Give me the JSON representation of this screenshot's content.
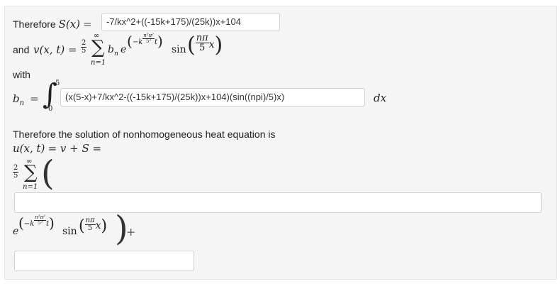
{
  "line1": {
    "therefore": "Therefore",
    "fn_S": "S",
    "arg_x": "(x)",
    "equals": "=",
    "input_value": "-7/kx^2+((-15k+175)/(25k))x+104"
  },
  "line2": {
    "and": "and",
    "fn_v": "v",
    "args": "(x, t)",
    "equals": "=",
    "coef_num": "2",
    "coef_den": "5",
    "sigma": "∑",
    "sum_upper": "∞",
    "sum_lower": "n=1",
    "b_n": "b",
    "sub_n": "n",
    "e": "e",
    "exp_minus_k": "−k",
    "exp_num": "n²π²",
    "exp_den": "5²",
    "exp_t": "t",
    "sin": "sin",
    "sin_num": "nπ",
    "sin_den": "5",
    "sin_x": "x"
  },
  "with_label": "with",
  "bn_line": {
    "b": "b",
    "sub_n": "n",
    "equals": "=",
    "integral": "∫",
    "upper": "5",
    "lower": "0",
    "input_value": "(x(5-x)+7/kx^2-((-15k+175)/(25k))x+104)(sin((npi)/5)x)",
    "dx": "dx"
  },
  "solution_text": "Therefore the solution of nonhomogeneous heat equation is",
  "u_line": {
    "fn_u": "u",
    "args": "(x, t)",
    "rest": "= v + S ="
  },
  "sum2": {
    "coef_num": "2",
    "coef_den": "5",
    "sigma": "∑",
    "upper": "∞",
    "lower": "n=1",
    "open_paren": "("
  },
  "answer_input_1": {
    "value": ""
  },
  "exp_line": {
    "e": "e",
    "exp_minus_k": "−k",
    "exp_num": "n²π²",
    "exp_den": "5²",
    "exp_t": "t",
    "sin": "sin",
    "sin_num": "nπ",
    "sin_den": "5",
    "sin_x": "x",
    "close_paren": ")",
    "plus": "+"
  },
  "answer_input_2": {
    "value": ""
  }
}
